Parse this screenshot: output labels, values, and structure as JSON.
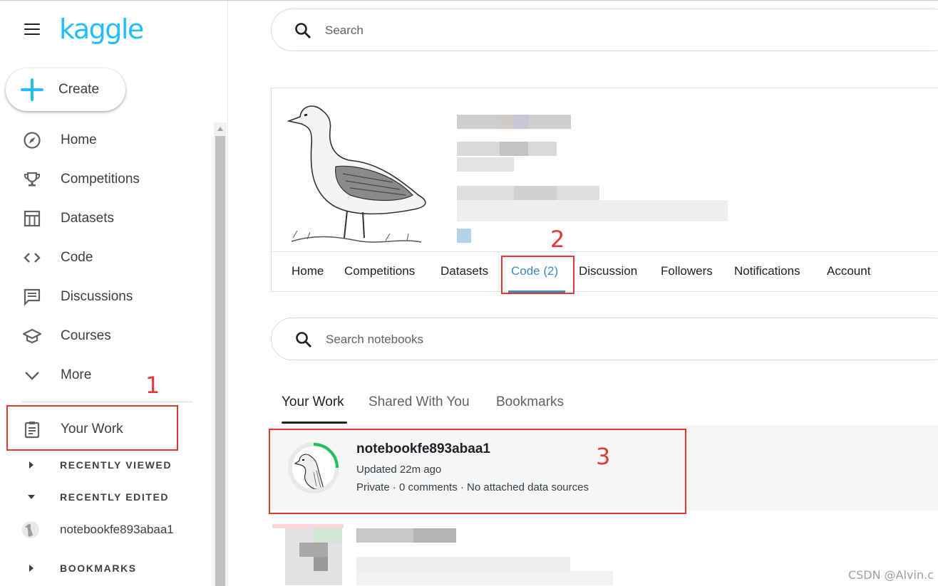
{
  "app": {
    "logo": "kaggle"
  },
  "sidebar": {
    "create_label": "Create",
    "items": [
      {
        "label": "Home",
        "icon": "compass-icon"
      },
      {
        "label": "Competitions",
        "icon": "trophy-icon"
      },
      {
        "label": "Datasets",
        "icon": "table-icon"
      },
      {
        "label": "Code",
        "icon": "code-icon"
      },
      {
        "label": "Discussions",
        "icon": "comment-icon"
      },
      {
        "label": "Courses",
        "icon": "graduation-cap-icon"
      },
      {
        "label": "More",
        "icon": "chevron-down-icon"
      }
    ],
    "your_work": {
      "label": "Your Work",
      "icon": "clipboard-icon"
    },
    "recently_viewed": "RECENTLY VIEWED",
    "recently_edited": "RECENTLY EDITED",
    "recent_notebook": "notebookfe893abaa1",
    "bookmarks": "BOOKMARKS"
  },
  "header": {
    "search_placeholder": "Search"
  },
  "profile": {
    "tabs": [
      "Home",
      "Competitions",
      "Datasets",
      "Code (2)",
      "Discussion",
      "Followers",
      "Notifications",
      "Account"
    ],
    "active_tab": "Code (2)"
  },
  "code": {
    "search_placeholder": "Search notebooks",
    "tabs": [
      "Your Work",
      "Shared With You",
      "Bookmarks"
    ],
    "active_tab": "Your Work",
    "notebook": {
      "title": "notebookfe893abaa1",
      "updated": "Updated 22m ago",
      "meta": "Private · 0 comments · No attached data sources"
    }
  },
  "annotations": {
    "n1": "1",
    "n2": "2",
    "n3": "3"
  },
  "watermark": "CSDN @Alvin.c",
  "colors": {
    "brand": "#20beff",
    "active_tab": "#3c8dbc",
    "annotation": "#e53935",
    "progress": "#20c05c"
  }
}
